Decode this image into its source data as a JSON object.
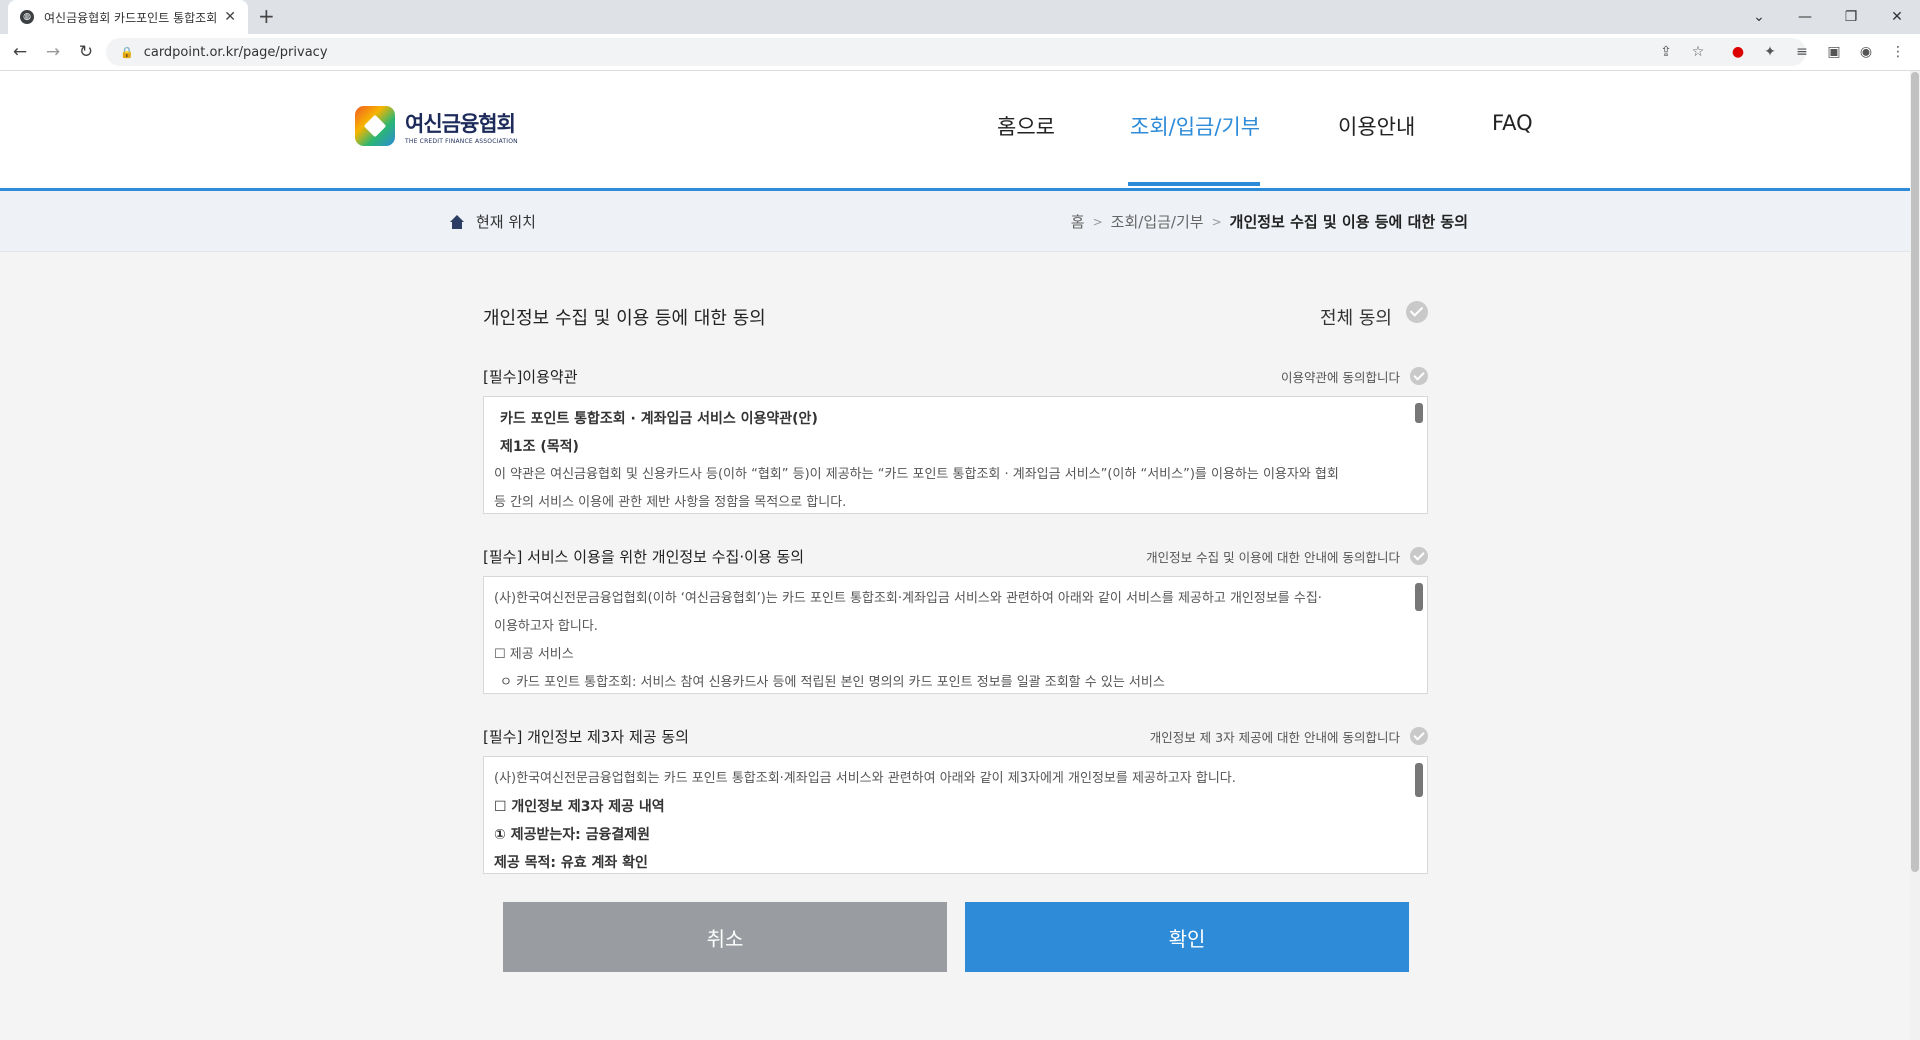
{
  "browser": {
    "tab_title": "여신금융협회 카드포인트 통합조회",
    "url": "cardpoint.or.kr/page/privacy"
  },
  "header": {
    "logo_name": "여신금융협회",
    "logo_sub": "THE CREDIT FINANCE ASSOCIATION",
    "nav": [
      "홈으로",
      "조회/입금/기부",
      "이용안내",
      "FAQ"
    ],
    "active_nav": "조회/입금/기부"
  },
  "breadcrumb": {
    "location_label": "현재 위치",
    "items": [
      "홈",
      "조회/입금/기부",
      "개인정보 수집 및 이용 등에 대한 동의"
    ],
    "separator": ">"
  },
  "main": {
    "title": "개인정보 수집 및 이용 등에 대한 동의",
    "all_agree": "전체 동의",
    "sections": [
      {
        "title": "[필수]이용약관",
        "agree_label": "이용약관에 동의합니다",
        "lines": [
          "카드 포인트 통합조회 · 계좌입금 서비스 이용약관(안)",
          "제1조 (목적)",
          "이 약관은 여신금융협회 및 신용카드사 등(이하 “협회” 등)이 제공하는 “카드 포인트 통합조회 · 계좌입금 서비스”(이하 “서비스”)를 이용하는 이용자와 협회",
          "등 간의 서비스 이용에 관한 제반 사항을 정함을 목적으로 합니다."
        ]
      },
      {
        "title": "[필수] 서비스 이용을 위한 개인정보 수집·이용 동의",
        "agree_label": "개인정보 수집 및 이용에 대한 안내에 동의합니다",
        "lines": [
          "(사)한국여신전문금융업협회(이하 ‘여신금융협회’)는 카드 포인트 통합조회·계좌입금 서비스와 관련하여 아래와 같이 서비스를 제공하고 개인정보를 수집·",
          "이용하고자 합니다.",
          "☐ 제공 서비스",
          "ㅇ 카드 포인트 통합조회: 서비스 참여 신용카드사 등에 적립된 본인 명의의 카드 포인트 정보를 일괄 조회할 수 있는 서비스"
        ]
      },
      {
        "title": "[필수] 개인정보 제3자 제공 동의",
        "agree_label": "개인정보 제 3자 제공에 대한 안내에 동의합니다",
        "lines": [
          "(사)한국여신전문금융업협회는 카드 포인트 통합조회·계좌입금 서비스와 관련하여 아래와 같이 제3자에게 개인정보를 제공하고자 합니다.",
          "☐ 개인정보 제3자 제공 내역",
          "① 제공받는자: 금융결제원",
          "제공 목적: 유효 계좌 확인"
        ]
      }
    ],
    "cancel_label": "취소",
    "confirm_label": "확인"
  }
}
